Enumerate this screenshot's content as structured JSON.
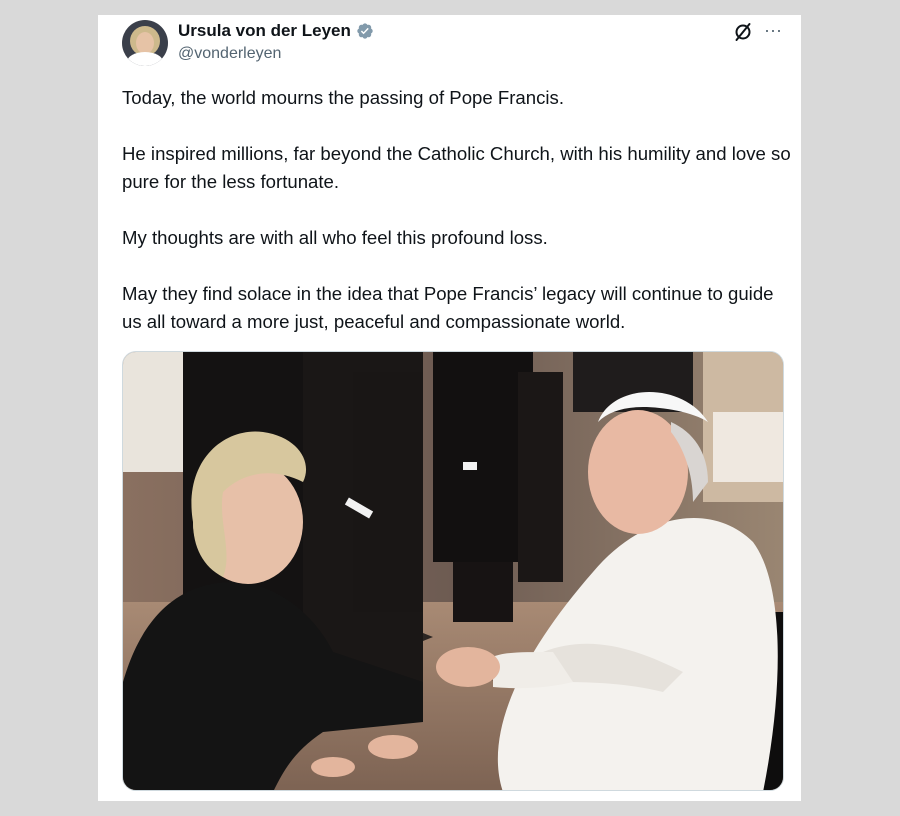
{
  "post": {
    "author": {
      "display_name": "Ursula von der Leyen",
      "handle": "@vonderleyen",
      "verified_badge_icon": "verified-badge-icon",
      "avatar_icon": "avatar-photo"
    },
    "toolbar": {
      "grok_icon": "grok-icon",
      "more_label": "···"
    },
    "text": {
      "p1": "Today, the world mourns the passing of Pope Francis.",
      "p2": "He inspired millions, far beyond the Catholic Church, with his humility and love so pure for the less fortunate.",
      "p3": "My thoughts are with all who feel this profound loss.",
      "p4": "May they find solace in the idea that Pope Francis’ legacy will continue to guide us all toward a more just, peaceful and compassionate world."
    },
    "media": {
      "type": "photo",
      "icon": "photo-handshake"
    }
  },
  "colors": {
    "page_bg": "#d9d9d9",
    "card_bg": "#ffffff",
    "text": "#0f1419",
    "secondary_text": "#536471",
    "verified_badge": "#829aab"
  }
}
